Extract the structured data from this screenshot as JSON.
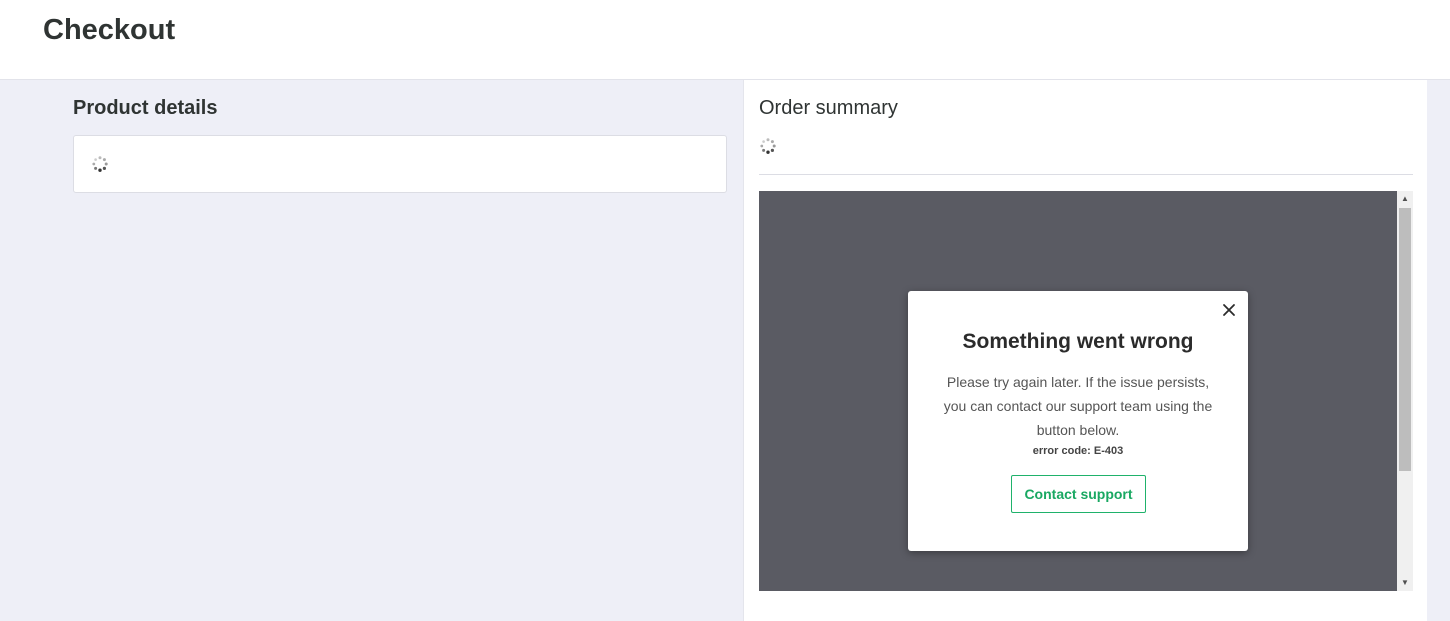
{
  "header": {
    "title": "Checkout"
  },
  "product": {
    "title": "Product details"
  },
  "summary": {
    "title": "Order summary"
  },
  "modal": {
    "title": "Something went wrong",
    "message": "Please try again later. If the issue persists, you can contact our support team using the button below.",
    "error_code": "error code: E-403",
    "contact_label": "Contact support"
  },
  "icons": {
    "spinner": "loading-spinner",
    "close": "close-x",
    "scroll_up": "triangle-up",
    "scroll_down": "triangle-down"
  },
  "colors": {
    "page_bg": "#eeeff7",
    "overlay": "#5a5b63",
    "accent": "#19a862"
  }
}
